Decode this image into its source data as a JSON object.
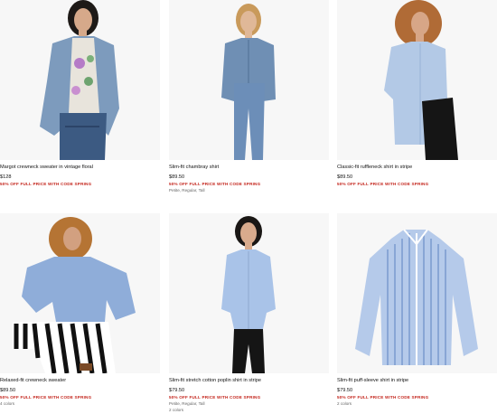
{
  "products": [
    {
      "name": "Margot crewneck sweater in vintage floral",
      "price": "$128",
      "promo": "50% OFF FULL PRICE WITH CODE SPRING",
      "extra": ""
    },
    {
      "name": "Slim-fit chambray shirt",
      "price": "$89.50",
      "promo": "50% OFF FULL PRICE WITH CODE SPRING",
      "extra": "Petite, Regular, Tall"
    },
    {
      "name": "Classic-fit ruffleneck shirt in stripe",
      "price": "$89.50",
      "promo": "50% OFF FULL PRICE WITH CODE SPRING",
      "extra": ""
    },
    {
      "name": "Relaxed-fit crewneck sweater",
      "price": "$89.50",
      "promo": "50% OFF FULL PRICE WITH CODE SPRING",
      "extra": "4 colors"
    },
    {
      "name": "Slim-fit stretch cotton poplin shirt in stripe",
      "price": "$79.50",
      "promo": "50% OFF FULL PRICE WITH CODE SPRING",
      "extra": "Petite, Regular, Tall",
      "extra2": "2 colors"
    },
    {
      "name": "Slim-fit puff-sleeve shirt in stripe",
      "price": "$79.50",
      "promo": "50% OFF FULL PRICE WITH CODE SPRING",
      "extra": "2 colors"
    }
  ]
}
